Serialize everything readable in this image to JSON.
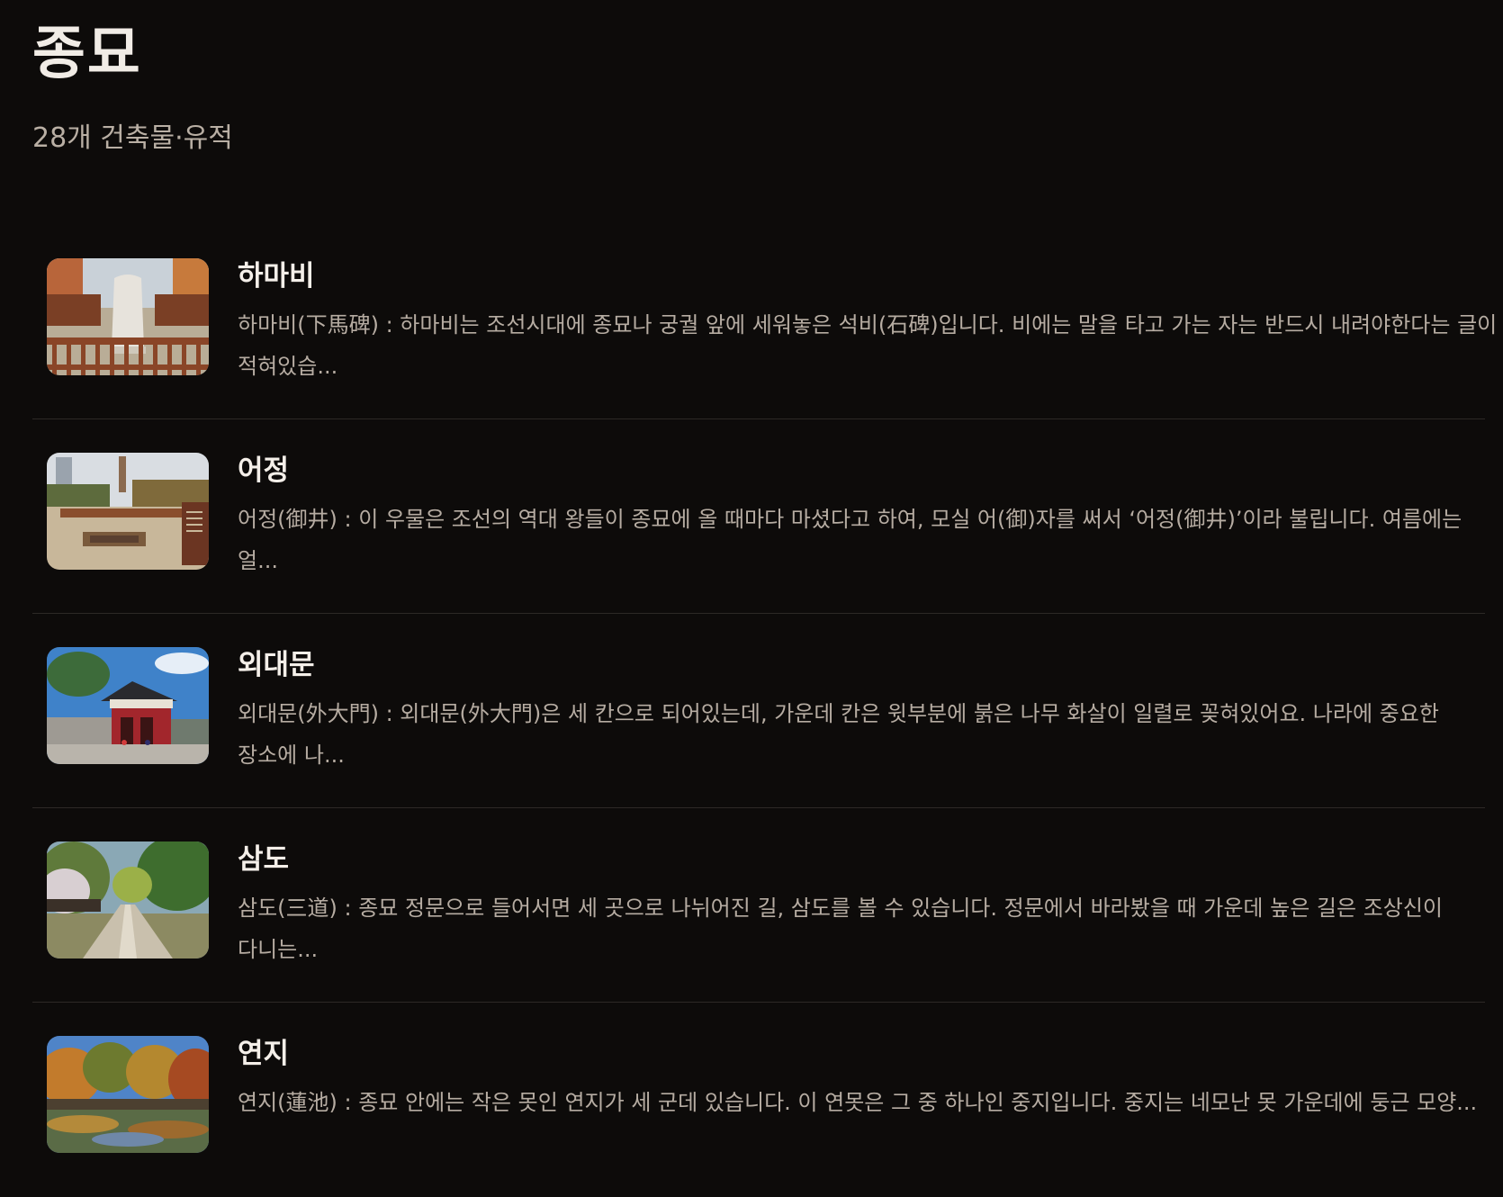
{
  "page": {
    "title": "종묘",
    "subtitle": "28개 건축물·유적"
  },
  "sites": [
    {
      "name": "하마비",
      "description": "하마비(下馬碑) : 하마비는 조선시대에 종묘나 궁궐 앞에 세워놓은 석비(石碑)입니다. 비에는 말을 타고 가는 자는 반드시 내려야한다는 글이 적혀있습...",
      "thumbnail": "stone-stele-photo"
    },
    {
      "name": "어정",
      "description": "어정(御井) : 이 우물은 조선의 역대 왕들이 종묘에 올 때마다 마셨다고 하여, 모실 어(御)자를 써서 ‘어정(御井)’이라 불립니다. 여름에는 얼...",
      "thumbnail": "royal-well-photo"
    },
    {
      "name": "외대문",
      "description": "외대문(外大門) : 외대문(外大門)은 세 칸으로 되어있는데, 가운데 칸은 윗부분에 붉은 나무 화살이 일렬로 꽂혀있어요. 나라에 중요한 장소에 나...",
      "thumbnail": "main-gate-photo"
    },
    {
      "name": "삼도",
      "description": "삼도(三道) : 종묘 정문으로 들어서면 세 곳으로 나뉘어진 길, 삼도를 볼 수 있습니다. 정문에서 바라봤을 때 가운데 높은 길은 조상신이 다니는...",
      "thumbnail": "three-path-photo"
    },
    {
      "name": "연지",
      "description": "연지(蓮池) : 종묘 안에는 작은 못인 연지가 세 군데 있습니다. 이 연못은 그 중 하나인 중지입니다. 중지는 네모난 못 가운데에 둥근 모양...",
      "thumbnail": "lotus-pond-photo"
    }
  ],
  "colors": {
    "background": "#0d0b0a",
    "title": "#f1ece6",
    "text_muted": "#b6aca2",
    "divider": "#2d2926"
  }
}
